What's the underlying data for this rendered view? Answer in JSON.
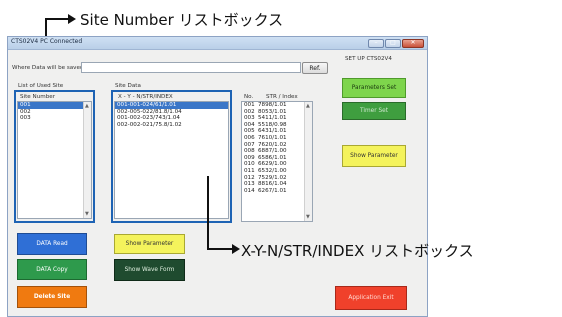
{
  "callouts": {
    "site_number": "Site Number リストボックス",
    "xyn": "X-Y-N/STR/INDEX リストボックス"
  },
  "window": {
    "title": "CTS02V4 PC Connected",
    "controls": [
      "min",
      "max",
      "close"
    ]
  },
  "save": {
    "label": "Where Data will be saved",
    "value": "",
    "ref_button": "Ref."
  },
  "setup_label": "SET UP CTS02V4",
  "used_site": {
    "label": "List of Used Site",
    "header": "Site Number",
    "items": [
      "001",
      "002",
      "003"
    ],
    "selected_index": 0
  },
  "site_data": {
    "label": "Site Data",
    "header": "X - Y - N/STR/INDEX",
    "items": [
      "001-001-024/61/1.01",
      "002-005-022/81.8/1.04",
      "001-002-023/743/1.04",
      "002-002-021/75.8/1.02"
    ],
    "selected_index": 0
  },
  "str_index": {
    "col_no": "No.",
    "col_value": "STR / Index",
    "rows": [
      [
        "001",
        "7898/1.01"
      ],
      [
        "002",
        "8053/1.01"
      ],
      [
        "003",
        "5411/1.01"
      ],
      [
        "004",
        "5518/0.98"
      ],
      [
        "005",
        "6431/1.01"
      ],
      [
        "006",
        "7610/1.01"
      ],
      [
        "007",
        "7620/1.02"
      ],
      [
        "008",
        "6887/1.00"
      ],
      [
        "009",
        "6586/1.01"
      ],
      [
        "010",
        "6629/1.00"
      ],
      [
        "011",
        "6532/1.00"
      ],
      [
        "012",
        "7529/1.02"
      ],
      [
        "013",
        "8816/1.04"
      ],
      [
        "014",
        "6267/1.01"
      ]
    ]
  },
  "buttons": {
    "data_read": "DATA Read",
    "data_copy": "DATA Copy",
    "delete_site": "Delete Site",
    "show_parameter_mid": "Show Parameter",
    "show_wave_form": "Show Wave Form",
    "parameters_set": "Parameters Set",
    "timer_set": "Timer Set",
    "show_parameter_right": "Show Parameter",
    "application_exit": "Application Exit"
  },
  "colors": {
    "highlight_box": "#1e63b4",
    "data_read": "#2f6fd6",
    "data_copy": "#2e9a4c",
    "delete_site": "#f07a10",
    "show_parameter": "#f4f35c",
    "show_wave_form": "#1f4b2f",
    "parameters_set": "#7ed54c",
    "timer_set": "#3f9e3f",
    "application_exit": "#f0412b"
  }
}
